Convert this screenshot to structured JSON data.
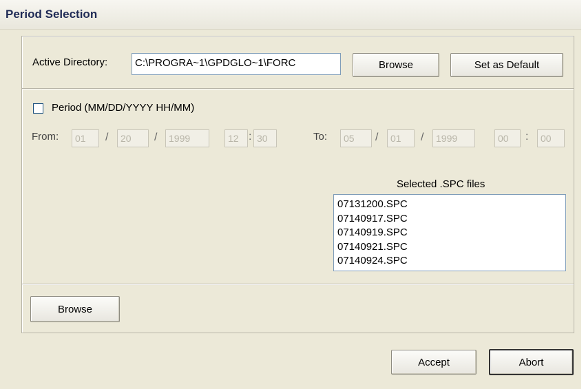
{
  "window": {
    "title": "Period Selection"
  },
  "directory": {
    "label": "Active Directory:",
    "value": "C:\\PROGRA~1\\GPDGLO~1\\FORC",
    "browse_label": "Browse",
    "set_default_label": "Set as Default"
  },
  "period": {
    "checkbox_label": "Period (MM/DD/YYYY HH/MM)",
    "checked": false,
    "from_label": "From:",
    "to_label": "To:",
    "from": {
      "month": "01",
      "day": "20",
      "year": "1999",
      "hour": "12",
      "minute": "30"
    },
    "to": {
      "month": "05",
      "day": "01",
      "year": "1999",
      "hour": "00",
      "minute": "00"
    },
    "date_sep": "/",
    "time_sep": ":"
  },
  "files": {
    "label": "Selected .SPC files",
    "items": [
      "07131200.SPC",
      "07140917.SPC",
      "07140919.SPC",
      "07140921.SPC",
      "07140924.SPC"
    ],
    "browse_label": "Browse"
  },
  "actions": {
    "accept_label": "Accept",
    "abort_label": "Abort"
  }
}
